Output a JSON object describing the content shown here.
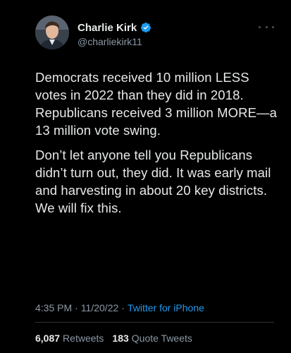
{
  "author": {
    "display_name": "Charlie Kirk",
    "handle": "@charliekirk11",
    "verified": true
  },
  "tweet": {
    "paragraphs": [
      "Democrats received 10 million LESS votes in 2022 than they did in 2018. Republicans received 3 million MORE—a 13 million vote swing.",
      "Don’t let anyone tell you Republicans didn’t turn out, they did. It was early mail and harvesting in about 20 key districts. We will fix this."
    ],
    "time": "4:35 PM",
    "separator": "·",
    "date": "11/20/22",
    "source": "Twitter for iPhone"
  },
  "stats": {
    "retweets_count": "6,087",
    "retweets_label": "Retweets",
    "quotes_count": "183",
    "quotes_label": "Quote Tweets"
  },
  "icons": {
    "verified": "verified-badge-icon",
    "more": "more-options-icon"
  },
  "colors": {
    "background": "#000000",
    "text": "#e7e9ea",
    "muted": "#8b98a5",
    "accent": "#1d9bf0"
  }
}
